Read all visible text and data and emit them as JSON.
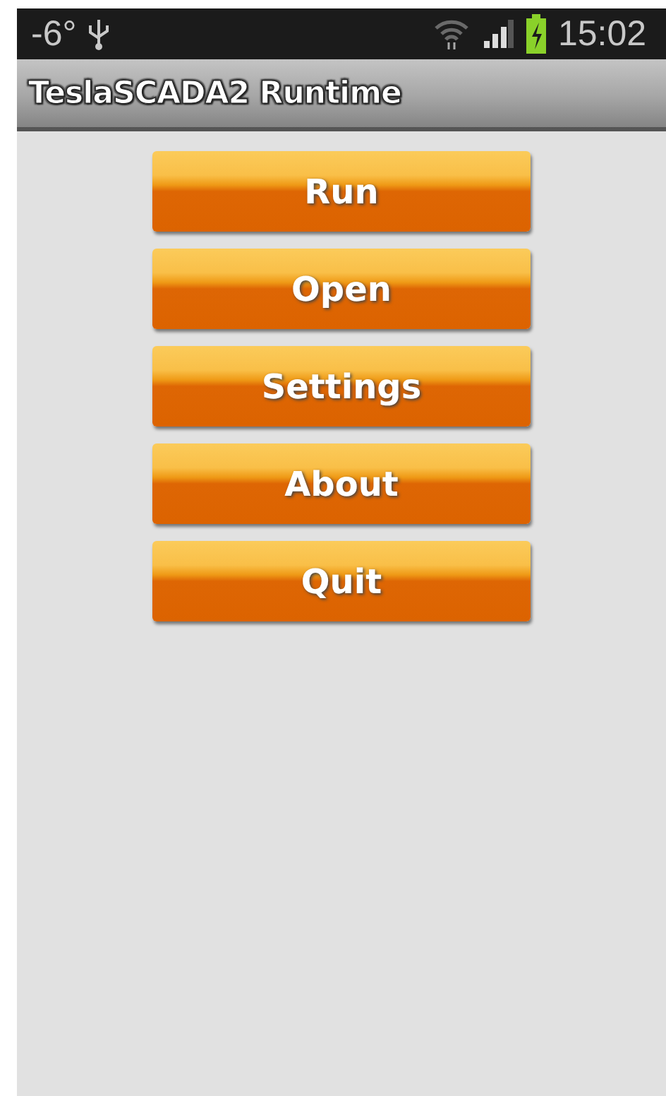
{
  "status_bar": {
    "temperature": "-6°",
    "time": "15:02"
  },
  "title_bar": {
    "title": "TeslaSCADA2 Runtime"
  },
  "buttons": [
    {
      "label": "Run"
    },
    {
      "label": "Open"
    },
    {
      "label": "Settings"
    },
    {
      "label": "About"
    },
    {
      "label": "Quit"
    }
  ]
}
